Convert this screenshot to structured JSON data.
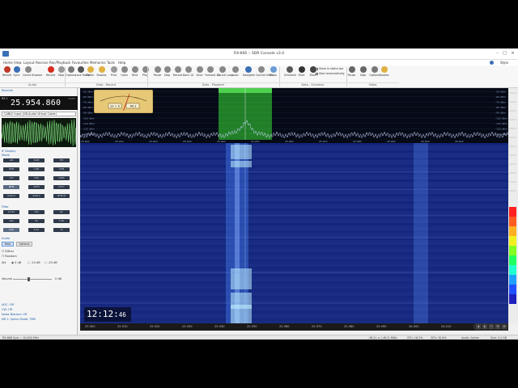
{
  "window": {
    "title": "RX-666 :: SDR Console v3.4"
  },
  "menu": {
    "items": [
      "Home",
      "View",
      "Layout",
      "Receive",
      "Rec/Playback",
      "Favourites",
      "Memories",
      "Tools",
      "Help"
    ],
    "style_label": "Style"
  },
  "ribbon": {
    "buttons": [
      {
        "label": "Record",
        "icon": "record-icon",
        "color": "#c0392b"
      },
      {
        "label": "Sync",
        "icon": "sync-icon",
        "color": "#3b6fb6"
      },
      {
        "label": "Cache Browser",
        "icon": "cache-icon",
        "color": "#888888"
      },
      {
        "label": "Record",
        "icon": "record-dot-icon",
        "color": "#d62d20"
      },
      {
        "label": "Stop",
        "icon": "stop-icon",
        "color": "#999999"
      },
      {
        "label": "Options",
        "icon": "options-icon",
        "color": "#7a7a7a"
      },
      {
        "label": "Lock Radio",
        "icon": "lock-icon",
        "color": "#555555"
      },
      {
        "label": "Folder",
        "icon": "folder-icon",
        "color": "#e0b040"
      },
      {
        "label": "Browse",
        "icon": "browse-icon",
        "color": "#e0b040"
      },
      {
        "label": "Print",
        "icon": "print-icon",
        "color": "#999999"
      },
      {
        "label": "Open",
        "icon": "open-icon",
        "color": "#888888"
      },
      {
        "label": "Rest",
        "icon": "rest-icon",
        "color": "#888888"
      },
      {
        "label": "Play",
        "icon": "play-icon",
        "color": "#888888"
      },
      {
        "label": "Pause",
        "icon": "pause-icon",
        "color": "#888888"
      },
      {
        "label": "Stop",
        "icon": "stop2-icon",
        "color": "#888888"
      },
      {
        "label": "Record",
        "icon": "record2-icon",
        "color": "#888888"
      },
      {
        "label": "Back 10",
        "icon": "back-icon",
        "color": "#888888"
      },
      {
        "label": "Save",
        "icon": "save-icon",
        "color": "#888888"
      },
      {
        "label": "Forward 10",
        "icon": "forward-icon",
        "color": "#888888"
      },
      {
        "label": "Cancel Loop",
        "icon": "cancel-loop-icon",
        "color": "#888888"
      },
      {
        "label": "Load",
        "icon": "load-icon",
        "color": "#888888"
      },
      {
        "label": "Navigate",
        "icon": "navigate-icon",
        "color": "#3b6fb6"
      },
      {
        "label": "Control Editor",
        "icon": "control-editor-icon",
        "color": "#888888"
      },
      {
        "label": "Show",
        "icon": "show-icon",
        "color": "#6b9bd6"
      },
      {
        "label": "Schedule",
        "icon": "schedule-icon",
        "color": "#5a5a5a"
      },
      {
        "label": "Start",
        "icon": "start-icon",
        "color": "#333333"
      },
      {
        "label": "Start",
        "icon": "video-start-icon",
        "color": "#444444"
      },
      {
        "label": "Pause",
        "icon": "video-pause-icon",
        "color": "#666666"
      },
      {
        "label": "Stop",
        "icon": "video-stop-icon",
        "color": "#666666"
      },
      {
        "label": "Options",
        "icon": "video-options-icon",
        "color": "#777777"
      },
      {
        "label": "Browse",
        "icon": "video-browse-icon",
        "color": "#e0b040"
      }
    ],
    "groups": [
      "Audio",
      "Data - Record",
      "Data - Playback",
      "Data - Schedule",
      "Video"
    ],
    "checks": [
      "Show in status bar",
      "Start automatically"
    ]
  },
  "left_panel": {
    "receive_header": "Receive",
    "vfo_label": "RX 1",
    "frequency": "25.954.860",
    "unit": "0 kHz",
    "input": "CABLE Input (VB-Audio Virtual Cable)",
    "if_display_header": "IF Display",
    "mode_header": "Mode",
    "mode_buttons": [
      "AM",
      "SAM",
      "FM",
      "DSB",
      "LSB",
      "USB",
      "CW",
      "CWr",
      "DRM",
      "NFM",
      "WFM",
      "RTTY",
      "SAM-U",
      "SAM-L",
      "NFM-W"
    ],
    "mode_selected": "NFM",
    "filter_header": "Filter",
    "filter_buttons": [
      "12.5k",
      "15k",
      "6k",
      "10k",
      "5k",
      "3.5k",
      "9.2k",
      "8.1k",
      "7k"
    ],
    "filter_selected": "9.2k",
    "audio_header": "Audio",
    "audio_tabs": [
      "Help",
      "Options"
    ],
    "dither_label": "Dither",
    "random_label": "Random",
    "att_label": "Att",
    "att_options": [
      "0 dB",
      "-10 dB",
      "-20 dB"
    ],
    "vol_label": "Volume",
    "vol_value": "0 dB",
    "agc_label": "AGC: Off",
    "cw_label": "CW: Off",
    "noise_blanker": "Noise Blanker: Off",
    "nr_label": "NR 1: Spline Mode: TMR"
  },
  "spectrum": {
    "db_ticks": [
      "-50 dBm",
      "-60 dBm",
      "-70 dBm",
      "-80 dBm",
      "-90 dBm",
      "-100 dBm",
      "-110 dBm",
      "-120 dBm",
      "-130 dBm"
    ],
    "freq_ticks": [
      "25.900",
      "25.910",
      "25.920",
      "25.930",
      "25.940",
      "25.950",
      "25.960",
      "25.970",
      "25.980",
      "25.990",
      "26.000",
      "26.010"
    ],
    "smeter_left": "S9 + 6",
    "smeter_right": "-66.3",
    "signal_color": "#38e038"
  },
  "waterfall": {
    "clock_main": "12:12:",
    "clock_sec": "46",
    "axis_ticks": [
      "25.900",
      "25.910",
      "25.920",
      "25.930",
      "25.940",
      "25.950",
      "25.960",
      "25.970",
      "25.980",
      "25.990",
      "26.000",
      "26.010",
      "26.020"
    ]
  },
  "status": {
    "left": "RX-666 Sync :: 10,000 MHz",
    "dac": "-38.21 ≥ (-48.5) MB/s",
    "cpu": "CPU: 16.2%",
    "gpu": "GPU: 30.6%",
    "audio": "Audio: Active",
    "size": "Size: 3.4 GB"
  }
}
